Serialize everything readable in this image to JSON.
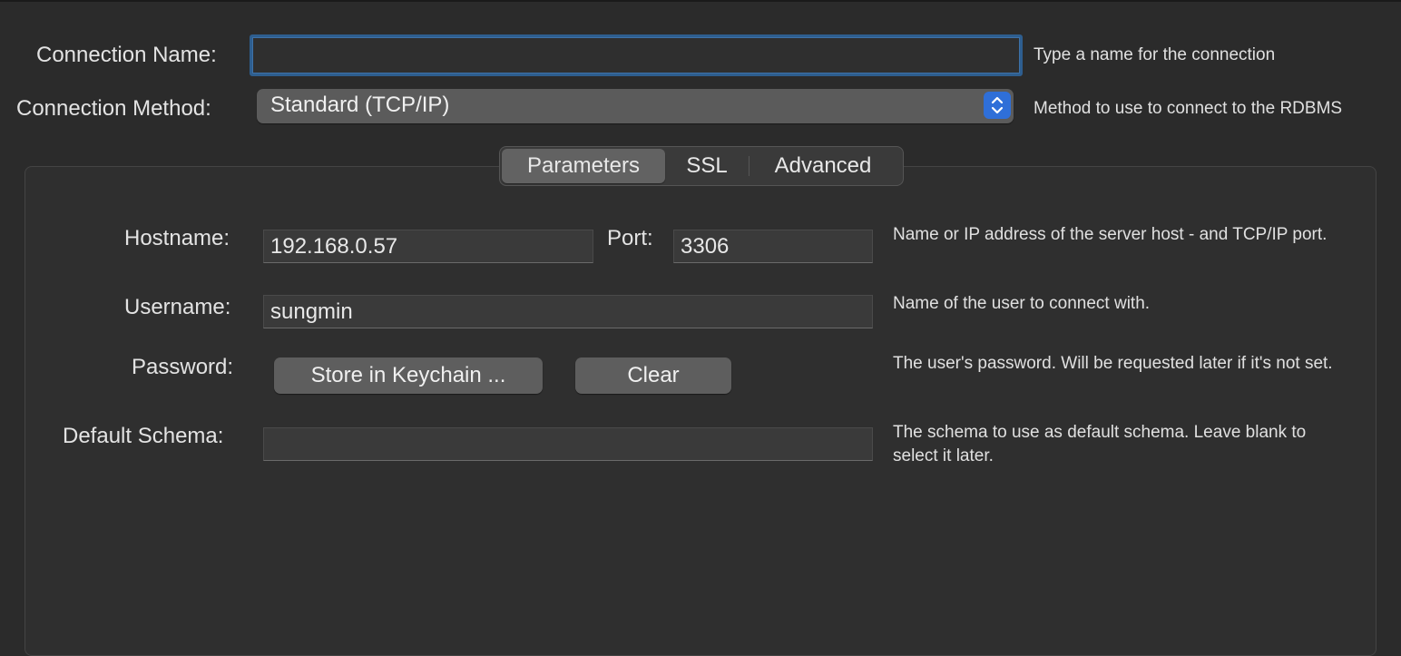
{
  "connection": {
    "name_label": "Connection Name:",
    "name_value": "",
    "name_hint": "Type a name for the connection",
    "method_label": "Connection Method:",
    "method_value": "Standard (TCP/IP)",
    "method_hint": "Method to use to connect to the RDBMS"
  },
  "tabs": [
    {
      "label": "Parameters",
      "active": true
    },
    {
      "label": "SSL",
      "active": false
    },
    {
      "label": "Advanced",
      "active": false
    }
  ],
  "params": {
    "hostname_label": "Hostname:",
    "hostname_value": "192.168.0.57",
    "port_label": "Port:",
    "port_value": "3306",
    "host_hint": "Name or IP address of the server host - and TCP/IP port.",
    "username_label": "Username:",
    "username_value": "sungmin",
    "username_hint": "Name of the user to connect with.",
    "password_label": "Password:",
    "store_button": "Store in Keychain ...",
    "clear_button": "Clear",
    "password_hint": "The user's password. Will be requested later if it's not set.",
    "schema_label": "Default Schema:",
    "schema_value": "",
    "schema_hint": "The schema to use as default schema. Leave blank to select it later."
  },
  "colors": {
    "accent": "#2f6fd8",
    "focus_ring": "#2e5e8f",
    "background": "#2b2b2b"
  },
  "icons": {
    "select_arrows": "chevron-up-down-icon"
  }
}
